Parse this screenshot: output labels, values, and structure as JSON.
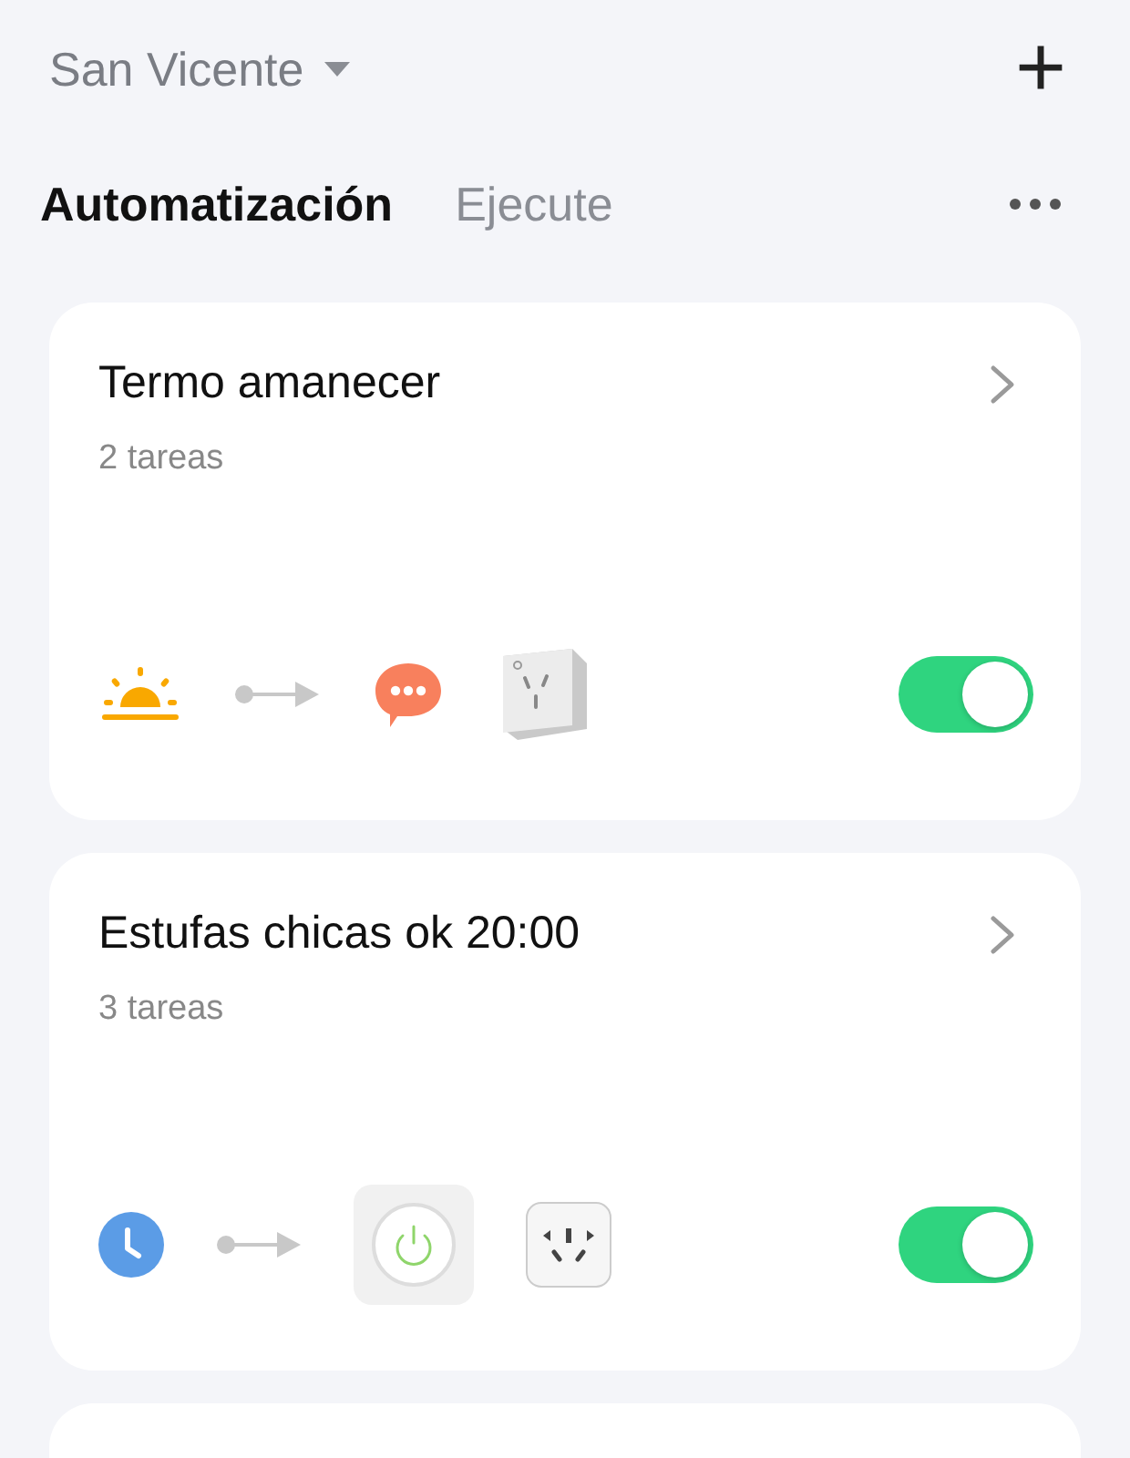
{
  "header": {
    "location": "San Vicente",
    "add_button": "+"
  },
  "tabs": [
    {
      "label": "Automatización",
      "selected": true
    },
    {
      "label": "Ejecute",
      "selected": false
    }
  ],
  "automations": [
    {
      "name": "Termo amanecer",
      "subtitle": "2 tareas",
      "on": true,
      "conditions": [
        {
          "kind": "sunrise"
        }
      ],
      "actions": [
        {
          "kind": "message"
        },
        {
          "kind": "plug"
        }
      ]
    },
    {
      "name": "Estufas chicas ok 20:00",
      "subtitle": "3 tareas",
      "on": true,
      "conditions": [
        {
          "kind": "clock"
        }
      ],
      "actions": [
        {
          "kind": "power"
        },
        {
          "kind": "socket"
        }
      ]
    }
  ]
}
